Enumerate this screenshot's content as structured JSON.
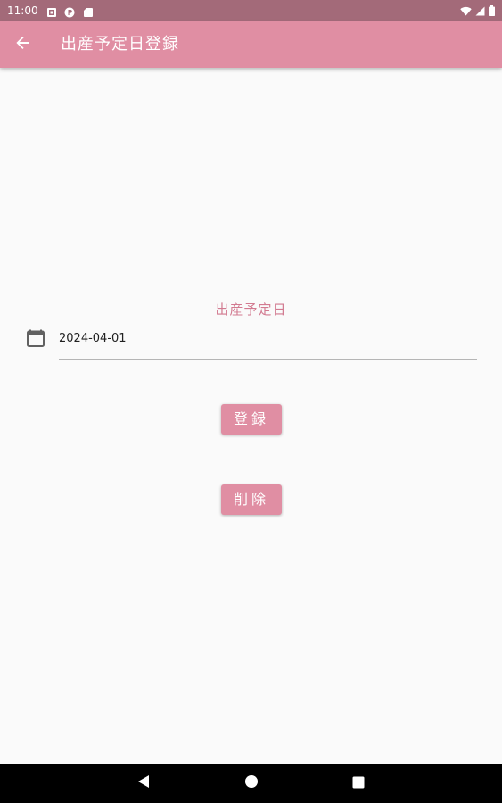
{
  "status_bar": {
    "time": "11:00",
    "notification_icons": [
      "notification-icon",
      "circle-p-icon",
      "sd-card-icon"
    ],
    "right_icons": [
      "wifi-icon",
      "signal-icon",
      "battery-icon"
    ]
  },
  "app_bar": {
    "title": "出産予定日登録",
    "back_icon": "arrow-left-icon"
  },
  "form": {
    "label": "出産予定日",
    "date_value": "2024-04-01",
    "calendar_icon": "calendar-icon"
  },
  "buttons": {
    "register_label": "登録",
    "delete_label": "削除"
  },
  "nav_bar": {
    "icons": [
      "back-triangle-icon",
      "home-circle-icon",
      "recents-square-icon"
    ]
  },
  "colors": {
    "status_bar": "#a36a79",
    "app_bar": "#e08ea3",
    "accent_text": "#d27a90",
    "background": "#fafafa",
    "nav_bar": "#000000"
  }
}
